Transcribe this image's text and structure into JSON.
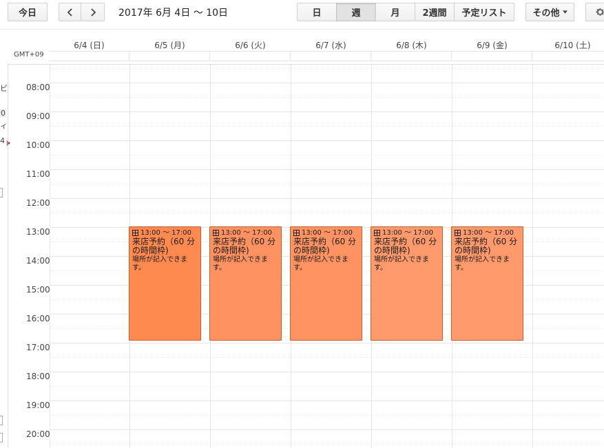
{
  "toolbar": {
    "today_label": "今日",
    "date_range": "2017年 6月 4日 〜 10日",
    "views": [
      "日",
      "週",
      "月",
      "2週間",
      "予定リスト"
    ],
    "active_view": "週",
    "more_label": "その他",
    "prev_icon": "chevron-left-icon",
    "next_icon": "chevron-right-icon",
    "settings_icon": "gear-icon"
  },
  "timezone_label": "GMT+09",
  "days": [
    "6/4 (日)",
    "6/5 (月)",
    "6/6 (火)",
    "6/7 (水)",
    "6/8 (木)",
    "6/9 (金)",
    "6/10 (土)"
  ],
  "hours": [
    "08:00",
    "09:00",
    "10:00",
    "11:00",
    "12:00",
    "13:00",
    "14:00",
    "15:00",
    "16:00",
    "17:00",
    "18:00",
    "19:00",
    "20:00"
  ],
  "events": [
    {
      "day_index": 1,
      "time": "13:00 〜 17:00",
      "title": "来店予約（60 分の時間枠)",
      "location": "場所が記入できます。",
      "color": "#ff8a50"
    },
    {
      "day_index": 2,
      "time": "13:00 〜 17:00",
      "title": "来店予約（60 分の時間枠)",
      "location": "場所が記入できます。",
      "color": "#ff9260"
    },
    {
      "day_index": 3,
      "time": "13:00 〜 17:00",
      "title": "来店予約（60 分の時間枠)",
      "location": "場所が記入できます。",
      "color": "#ff9462"
    },
    {
      "day_index": 4,
      "time": "13:00 〜 17:00",
      "title": "来店予約（60 分の時間枠)",
      "location": "場所が記入できます。",
      "color": "#ff9a6c"
    },
    {
      "day_index": 5,
      "time": "13:00 〜 17:00",
      "title": "来店予約（60 分の時間枠)",
      "location": "場所が記入できます。",
      "color": "#ff9a6c"
    }
  ],
  "left_fragments": [
    "ビ",
    "0",
    "ィ",
    "4"
  ]
}
